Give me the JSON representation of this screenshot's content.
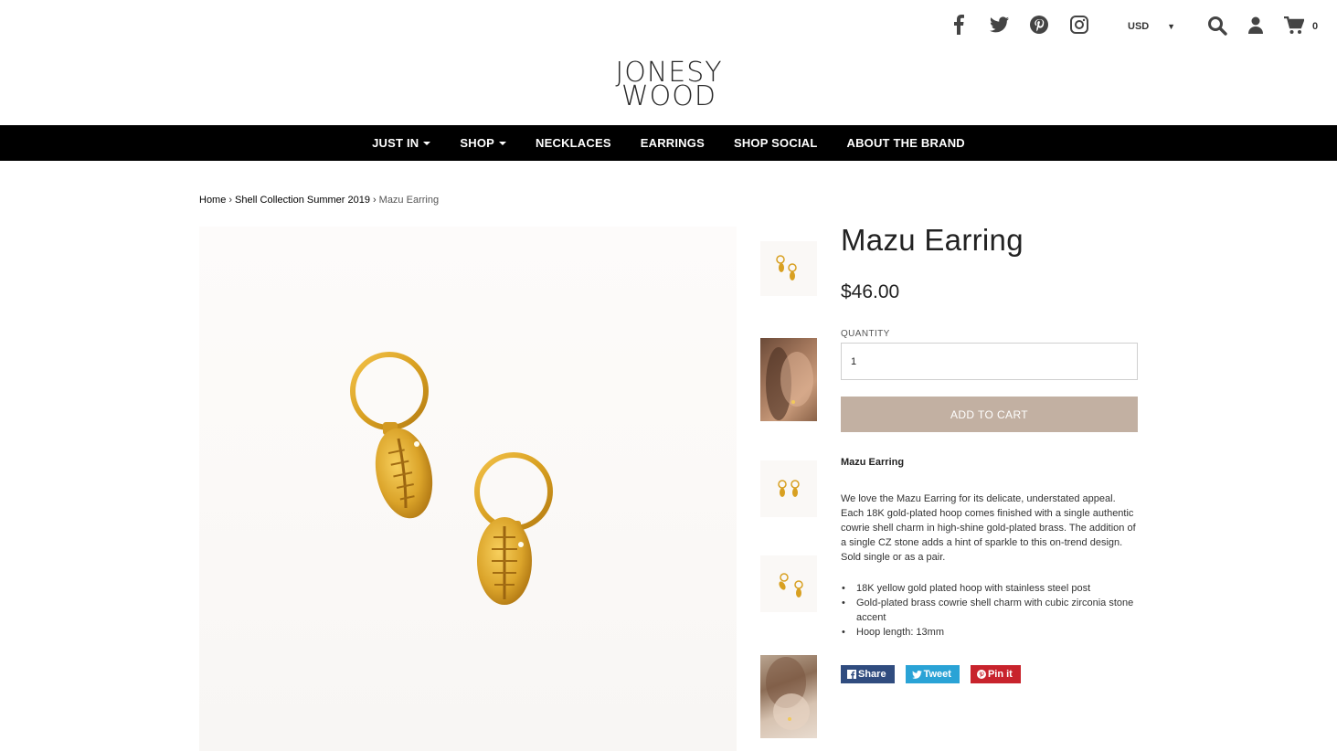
{
  "header": {
    "currency": "USD",
    "cart_count": "0",
    "logo_line1": "JONESY",
    "logo_line2": "WOOD",
    "social_icons": [
      "facebook-icon",
      "twitter-icon",
      "pinterest-icon",
      "instagram-icon"
    ],
    "util_icons": [
      "search-icon",
      "user-icon",
      "cart-icon"
    ]
  },
  "nav": {
    "items": [
      "JUST IN",
      "SHOP",
      "NECKLACES",
      "EARRINGS",
      "SHOP SOCIAL",
      "ABOUT THE BRAND"
    ]
  },
  "breadcrumb": {
    "home": "Home",
    "collection": "Shell Collection Summer 2019",
    "current": "Mazu Earring",
    "separator": "›"
  },
  "product": {
    "title": "Mazu Earring",
    "price": "$46.00",
    "quantity_label": "QUANTITY",
    "quantity_value": "1",
    "add_to_cart": "ADD TO CART",
    "desc_title": "Mazu Earring",
    "description": "We love the Mazu Earring for its delicate, understated appeal. Each 18K gold-plated hoop comes finished with a single authentic cowrie shell charm in high-shine gold-plated brass. The addition of a single CZ stone adds a hint of sparkle to this on-trend design. Sold single or as a pair.",
    "bullets": [
      "18K yellow gold plated hoop with stainless steel post",
      "Gold-plated brass cowrie shell charm with cubic zirconia stone accent",
      "Hoop length: 13mm"
    ]
  },
  "share": {
    "facebook": "Share",
    "twitter": "Tweet",
    "pinterest": "Pin it"
  },
  "colors": {
    "nav_bg": "#000000",
    "add_to_cart_bg": "#c2b0a2",
    "facebook": "#304c7f",
    "twitter": "#2aa3d6",
    "pinterest": "#c8232c",
    "gold": "#d8a021"
  }
}
